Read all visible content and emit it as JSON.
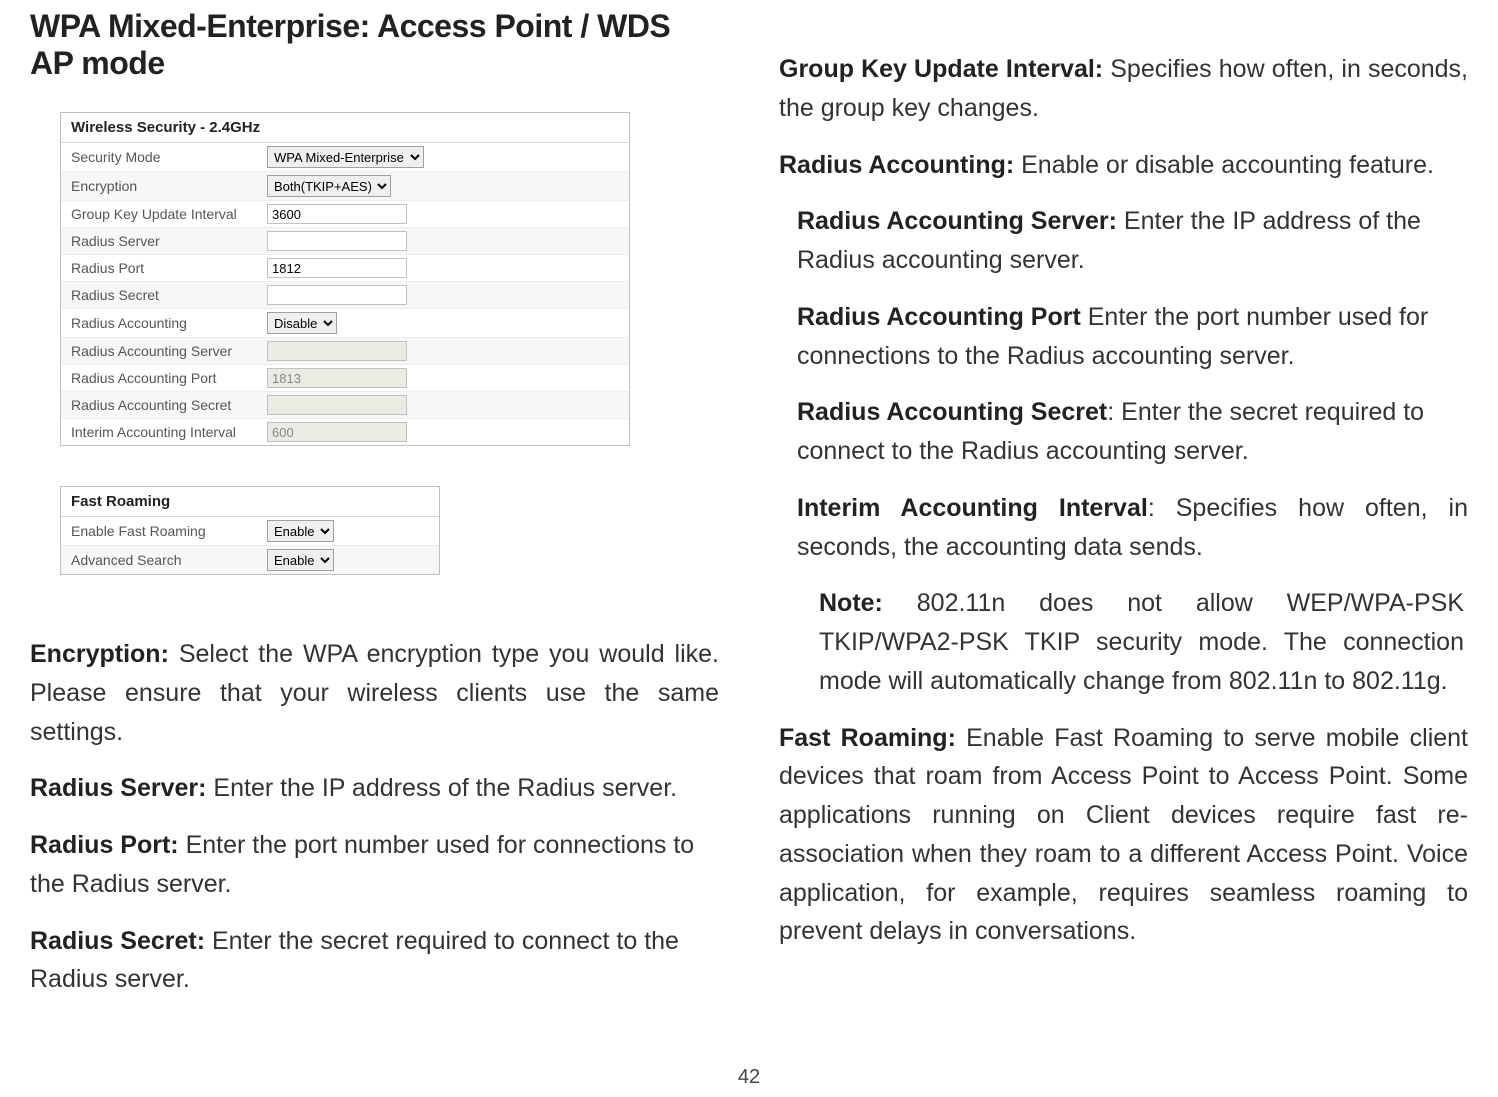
{
  "title": "WPA Mixed-Enterprise: Access Point / WDS AP mode",
  "page_number": "42",
  "security_panel": {
    "header": "Wireless Security - 2.4GHz",
    "rows": {
      "security_mode": {
        "label": "Security Mode",
        "value": "WPA Mixed-Enterprise"
      },
      "encryption": {
        "label": "Encryption",
        "value": "Both(TKIP+AES)"
      },
      "group_key": {
        "label": "Group Key Update Interval",
        "value": "3600"
      },
      "radius_server": {
        "label": "Radius Server",
        "value": ""
      },
      "radius_port": {
        "label": "Radius Port",
        "value": "1812"
      },
      "radius_secret": {
        "label": "Radius Secret",
        "value": ""
      },
      "radius_accounting": {
        "label": "Radius Accounting",
        "value": "Disable"
      },
      "ra_server": {
        "label": "Radius Accounting Server",
        "value": ""
      },
      "ra_port": {
        "label": "Radius Accounting Port",
        "value": "1813"
      },
      "ra_secret": {
        "label": "Radius Accounting Secret",
        "value": ""
      },
      "interim": {
        "label": "Interim Accounting Interval",
        "value": "600"
      }
    }
  },
  "roaming_panel": {
    "header": "Fast Roaming",
    "rows": {
      "enable_fast_roaming": {
        "label": "Enable Fast Roaming",
        "value": "Enable"
      },
      "advanced_search": {
        "label": "Advanced Search",
        "value": "Enable"
      }
    }
  },
  "left_paras": {
    "encryption": {
      "term": "Encryption:",
      "text": " Select the WPA encryption type you would like. Please ensure that your wireless clients use the same settings."
    },
    "radius_server": {
      "term": "Radius Server:",
      "text": " Enter the IP address of the Radius server."
    },
    "radius_port": {
      "term": "Radius Port:",
      "text": " Enter the port number used for connections to the Radius server."
    },
    "radius_secret": {
      "term": "Radius Secret:",
      "text": " Enter the secret required to connect to the Radius server."
    }
  },
  "right_paras": {
    "group_key": {
      "term": "Group Key Update Interval:",
      "text": " Specifies how often, in seconds, the group key changes."
    },
    "radius_accounting": {
      "term": "Radius Accounting:",
      "text": " Enable or disable accounting feature."
    },
    "ra_server": {
      "term": "Radius Accounting Server:",
      "text": " Enter the IP address of the Radius accounting server."
    },
    "ra_port": {
      "term": "Radius Accounting Port",
      "text": " Enter the port number used for connections to the Radius accounting server."
    },
    "ra_secret": {
      "term": "Radius Accounting Secret",
      "text": ": Enter the secret required to connect to the Radius accounting server."
    },
    "interim": {
      "term": "Interim Accounting Interval",
      "text": ": Specifies how often, in seconds, the accounting data sends."
    },
    "note": {
      "term": "Note:",
      "text": " 802.11n does not allow WEP/WPA-PSK TKIP/WPA2-PSK TKIP security mode. The connection mode will automatically change from 802.11n to 802.11g."
    },
    "fast_roaming": {
      "term": "Fast Roaming:",
      "text": " Enable Fast Roaming to serve mobile client devices that roam from Access Point to Access Point. Some applications running on Client devices require fast re-association when they roam to a different Access Point. Voice application, for example, requires seamless roaming to prevent delays in conversations."
    }
  }
}
